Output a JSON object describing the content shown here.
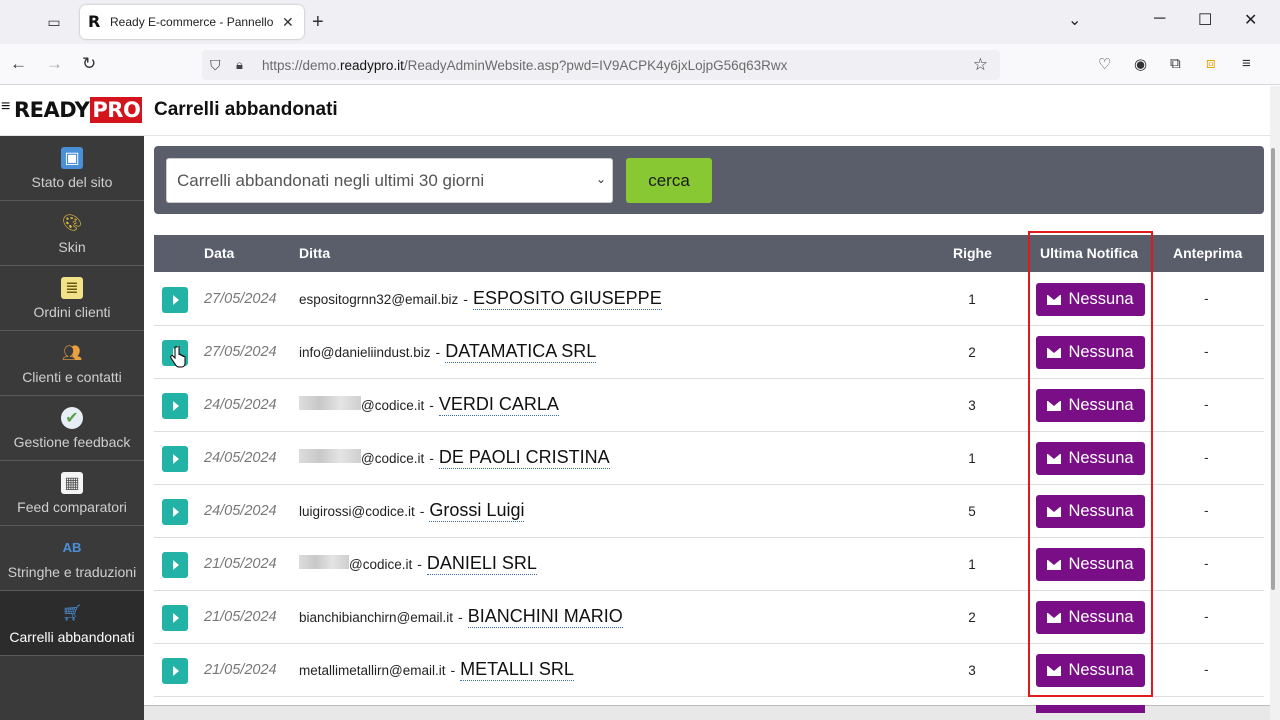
{
  "browser": {
    "tab_title": "Ready E-commerce - Pannello amministrazione",
    "url_prefix": "https://demo.",
    "url_domain": "readypro.it",
    "url_suffix": "/ReadyAdminWebsite.asp?pwd=IV9ACPK4y6jxLojpG56q63Rwx"
  },
  "app": {
    "logo_ready": "READY",
    "logo_pro": "PRO",
    "page_title": "Carrelli abbandonati"
  },
  "sidebar": {
    "items": [
      {
        "label": "Stato del sito",
        "icon": "monitor-icon"
      },
      {
        "label": "Skin",
        "icon": "palette-icon"
      },
      {
        "label": "Ordini clienti",
        "icon": "notepad-icon"
      },
      {
        "label": "Clienti e contatti",
        "icon": "users-icon"
      },
      {
        "label": "Gestione feedback",
        "icon": "speech-bubble-icon"
      },
      {
        "label": "Feed comparatori",
        "icon": "grid-icon"
      },
      {
        "label": "Stringhe e traduzioni",
        "icon": "ab-translate-icon"
      },
      {
        "label": "Carrelli abbandonati",
        "icon": "cart-icon"
      }
    ]
  },
  "filter": {
    "selected": "Carrelli abbandonati negli ultimi 30 giorni",
    "button": "cerca"
  },
  "table": {
    "headers": {
      "data": "Data",
      "ditta": "Ditta",
      "righe": "Righe",
      "notifica": "Ultima Notifica",
      "anteprima": "Anteprima"
    },
    "rows": [
      {
        "date": "27/05/2024",
        "email": "espositogrnn32@email.biz",
        "company": "ESPOSITO GIUSEPPE",
        "righe": "1",
        "notifica": "Nessuna",
        "anteprima": "-"
      },
      {
        "date": "27/05/2024",
        "email": "info@danieliindust.biz",
        "company": "DATAMATICA SRL",
        "righe": "2",
        "notifica": "Nessuna",
        "anteprima": "-"
      },
      {
        "date": "24/05/2024",
        "email": "@codice.it",
        "company": "VERDI CARLA",
        "righe": "3",
        "notifica": "Nessuna",
        "anteprima": "-"
      },
      {
        "date": "24/05/2024",
        "email": "@codice.it",
        "company": "DE PAOLI CRISTINA",
        "righe": "1",
        "notifica": "Nessuna",
        "anteprima": "-"
      },
      {
        "date": "24/05/2024",
        "email": "luigirossi@codice.it",
        "company": "Grossi Luigi",
        "righe": "5",
        "notifica": "Nessuna",
        "anteprima": "-"
      },
      {
        "date": "21/05/2024",
        "email": "@codice.it",
        "company": "DANIELI SRL",
        "righe": "1",
        "notifica": "Nessuna",
        "anteprima": "-"
      },
      {
        "date": "21/05/2024",
        "email": "bianchibianchirn@email.it",
        "company": "BIANCHINI MARIO",
        "righe": "2",
        "notifica": "Nessuna",
        "anteprima": "-"
      },
      {
        "date": "21/05/2024",
        "email": "metallimetallirn@email.it",
        "company": "METALLI SRL",
        "righe": "3",
        "notifica": "Nessuna",
        "anteprima": "-"
      }
    ]
  },
  "colors": {
    "expand": "#22b3a6",
    "notif": "#7a0e87",
    "cerca": "#88c832",
    "highlight": "#e01a1a"
  }
}
